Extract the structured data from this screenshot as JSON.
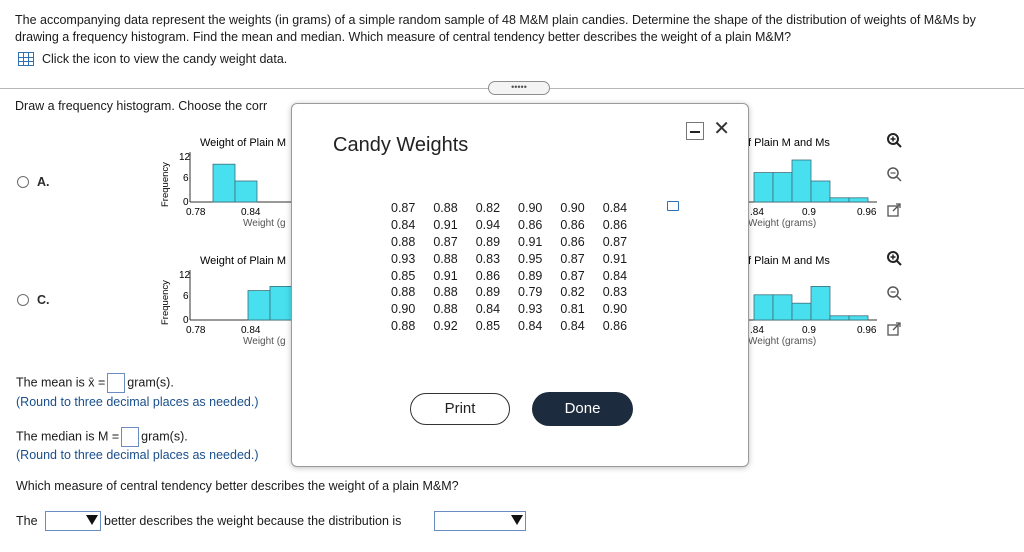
{
  "question": {
    "text": "The accompanying data represent the weights (in grams) of a simple random sample of 48 M&M plain candies. Determine the shape of the distribution of weights of M&Ms by drawing a frequency histogram. Find the mean and median. Which measure of central tendency better describes the weight of a plain M&M?",
    "data_link": "Click the icon to view the candy weight data."
  },
  "expander_label": "•••••",
  "section": {
    "label": "Draw a frequency histogram. Choose the corr"
  },
  "options": [
    {
      "letter": "A.",
      "left_title": "Weight of Plain M",
      "right_title": "f Plain M and Ms",
      "ylabel": "Frequency",
      "left_ticks_y": [
        "12",
        "6",
        "0"
      ],
      "left_ticks_x": [
        "0.78",
        "0.84"
      ],
      "left_xlabel": "Weight (g",
      "right_ticks_x": [
        ".84",
        "0.9",
        "0.96"
      ],
      "right_xlabel": "Weight (grams)"
    },
    {
      "letter": "C.",
      "left_title": "Weight of Plain M",
      "right_title": "f Plain M and Ms",
      "ylabel": "Frequency",
      "left_ticks_y": [
        "12",
        "6",
        "0"
      ],
      "left_ticks_x": [
        "0.78",
        "0.84"
      ],
      "left_xlabel": "Weight (g",
      "right_ticks_x": [
        ".84",
        "0.9",
        "0.96"
      ],
      "right_xlabel": "Weight (grams)"
    }
  ],
  "chart_data": [
    {
      "type": "bar",
      "title": "Weight of Plain M",
      "ylabel": "Frequency",
      "xlabel": "Weight (g",
      "ylim": [
        0,
        12
      ],
      "visible_values": [
        9,
        5
      ]
    },
    {
      "type": "bar",
      "title": "f Plain M and Ms",
      "xlabel": "Weight (grams)",
      "visible_values": [
        7,
        7,
        10,
        5,
        1,
        1
      ]
    },
    {
      "type": "bar",
      "title": "Weight of Plain M",
      "ylabel": "Frequency",
      "xlabel": "Weight (g",
      "ylim": [
        0,
        12
      ],
      "visible_values": [
        7,
        8
      ]
    },
    {
      "type": "bar",
      "title": "f Plain M and Ms",
      "xlabel": "Weight (grams)",
      "visible_values": [
        6,
        6,
        4,
        8,
        1,
        1
      ]
    }
  ],
  "answers": {
    "mean_prefix": "The mean is x̄ =",
    "mean_suffix": "gram(s).",
    "mean_hint": "(Round to three decimal places as needed.)",
    "median_prefix": "The median is M =",
    "median_suffix": "gram(s).",
    "median_hint": "(Round to three decimal places as needed.)",
    "measure_question": "Which measure of central tendency better describes the weight of a plain M&M?",
    "final_prefix": "The",
    "final_middle": "better describes the weight because the distribution is"
  },
  "modal": {
    "title": "Candy Weights",
    "rows": [
      [
        "0.87",
        "0.88",
        "0.82",
        "0.90",
        "0.90",
        "0.84"
      ],
      [
        "0.84",
        "0.91",
        "0.94",
        "0.86",
        "0.86",
        "0.86"
      ],
      [
        "0.88",
        "0.87",
        "0.89",
        "0.91",
        "0.86",
        "0.87"
      ],
      [
        "0.93",
        "0.88",
        "0.83",
        "0.95",
        "0.87",
        "0.91"
      ],
      [
        "0.85",
        "0.91",
        "0.86",
        "0.89",
        "0.87",
        "0.84"
      ],
      [
        "0.88",
        "0.88",
        "0.89",
        "0.79",
        "0.82",
        "0.83"
      ],
      [
        "0.90",
        "0.88",
        "0.84",
        "0.93",
        "0.81",
        "0.90"
      ],
      [
        "0.88",
        "0.92",
        "0.85",
        "0.84",
        "0.84",
        "0.86"
      ]
    ],
    "print_label": "Print",
    "done_label": "Done",
    "close_label": "✕"
  },
  "colors": {
    "bar_fill": "#48e0ee",
    "bar_stroke": "#3c6e7a",
    "hint": "#1a4f8c",
    "done_bg": "#1d2b3e"
  }
}
